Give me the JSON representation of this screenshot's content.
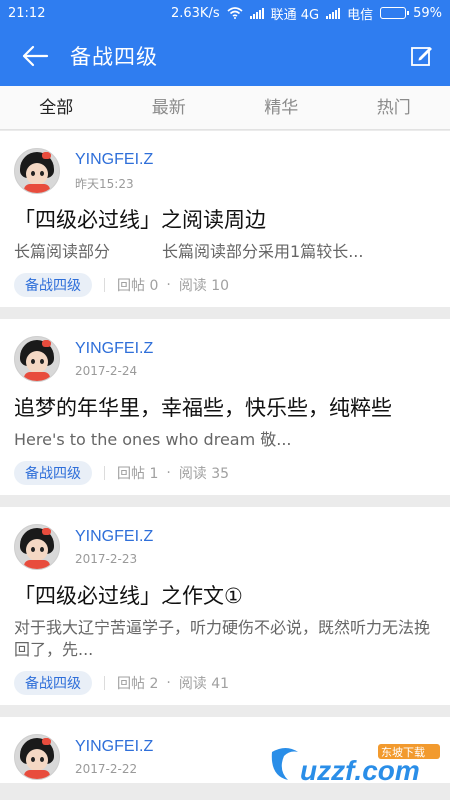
{
  "status_bar": {
    "time": "21:12",
    "speed": "2.63K/s",
    "carrier1": "联通 4G",
    "carrier2": "电信",
    "battery": "59%",
    "battery_level": 0.59
  },
  "header": {
    "title": "备战四级"
  },
  "tabs": [
    "全部",
    "最新",
    "精华",
    "热门"
  ],
  "posts": [
    {
      "author": "YINGFEI.Z",
      "date": "昨天15:23",
      "title": "「四级必过线」之阅读周边",
      "excerpt_a": "长篇阅读部分",
      "excerpt_b": "长篇阅读部分采用1篇较长...",
      "tag": "备战四级",
      "replies": "回帖 0",
      "reads": "阅读 10"
    },
    {
      "author": "YINGFEI.Z",
      "date": "2017-2-24",
      "title": "追梦的年华里，幸福些，快乐些，纯粹些",
      "excerpt": "Here's to the ones who dream 敬...",
      "tag": "备战四级",
      "replies": "回帖 1",
      "reads": "阅读 35"
    },
    {
      "author": "YINGFEI.Z",
      "date": "2017-2-23",
      "title": "「四级必过线」之作文①",
      "excerpt": "对于我大辽宁苦逼学子，听力硬伤不必说，既然听力无法挽回了，先...",
      "tag": "备战四级",
      "replies": "回帖 2",
      "reads": "阅读 41"
    },
    {
      "author": "YINGFEI.Z",
      "date": "2017-2-22"
    }
  ],
  "watermark": {
    "text": "uzzf.com",
    "sub": "东坡下载"
  },
  "colors": {
    "accent": "#2f7df0",
    "author": "#2f6fd9"
  }
}
